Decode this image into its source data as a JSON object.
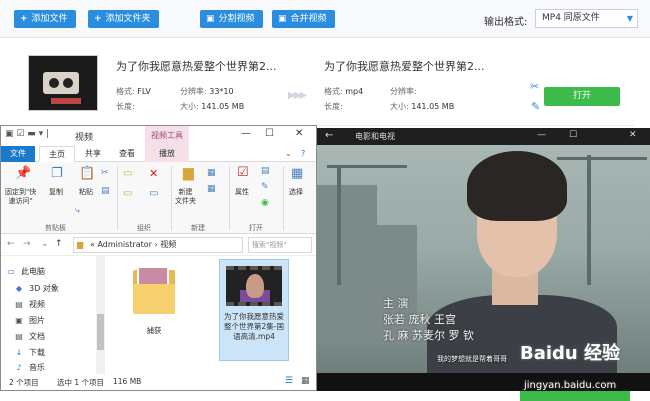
{
  "converter": {
    "toolbar": {
      "add_file": "添加文件",
      "add_folder": "添加文件夹",
      "split_video": "分割视频",
      "merge_video": "合并视频",
      "output_format_label": "输出格式:",
      "output_format_value": "MP4 同原文件"
    },
    "source": {
      "title": "为了你我愿意热爱整个世界第2...",
      "format_label": "格式:",
      "format": "FLV",
      "resolution_label": "分辨率:",
      "resolution": "33*10",
      "duration_label": "长度:",
      "duration": "",
      "size_label": "大小:",
      "size": "141.05 MB"
    },
    "target": {
      "title": "为了你我愿意热爱整个世界第2...",
      "format_label": "格式:",
      "format": "mp4",
      "resolution_label": "分辨率:",
      "resolution": "",
      "duration_label": "长度:",
      "duration": "",
      "size_label": "大小:",
      "size": "141.05 MB"
    },
    "open_button": "打开",
    "accent_color": "#2b8de0",
    "open_color": "#3dbb4a"
  },
  "explorer": {
    "title": "视频",
    "context_tab": "视频工具",
    "ribbon_tabs": [
      "文件",
      "主页",
      "共享",
      "查看",
      "播放"
    ],
    "ribbon": {
      "pin_quick_access": "固定到\"快\n速访问\"",
      "copy": "复制",
      "paste": "粘贴",
      "clipboard_group": "剪贴板",
      "organize_group": "组织",
      "new_folder": "新建\n文件夹",
      "new_group": "新建",
      "properties": "属性",
      "open_group": "打开",
      "select": "选择"
    },
    "address": {
      "path_root": "Administrator",
      "path_current": "视频",
      "search_placeholder": "搜索\"视频\""
    },
    "nav_items": [
      {
        "label": "此电脑",
        "icon": "computer-icon"
      },
      {
        "label": "3D 对象",
        "icon": "cube-icon"
      },
      {
        "label": "视频",
        "icon": "video-folder-icon"
      },
      {
        "label": "图片",
        "icon": "picture-folder-icon"
      },
      {
        "label": "文档",
        "icon": "document-folder-icon"
      },
      {
        "label": "下载",
        "icon": "download-icon"
      },
      {
        "label": "音乐",
        "icon": "music-icon"
      }
    ],
    "files": {
      "folder_name": "捕获",
      "video_name": "为了你我愿意热爱整个世界第2集-国语高清.mp4"
    },
    "status": {
      "item_count": "2 个项目",
      "selected": "选中 1 个项目",
      "size": "116 MB"
    }
  },
  "player": {
    "title": "电影和电视",
    "credits": {
      "line1": "主 演",
      "line2": "张若 庞秋 王宫",
      "line3": "孔 麻 苏麦尔 罗 钦"
    },
    "subtitle": "我的梦想就是帮着哥哥",
    "watermark": "Baidu 经验",
    "watermark_url": "jingyan.baidu.com"
  }
}
